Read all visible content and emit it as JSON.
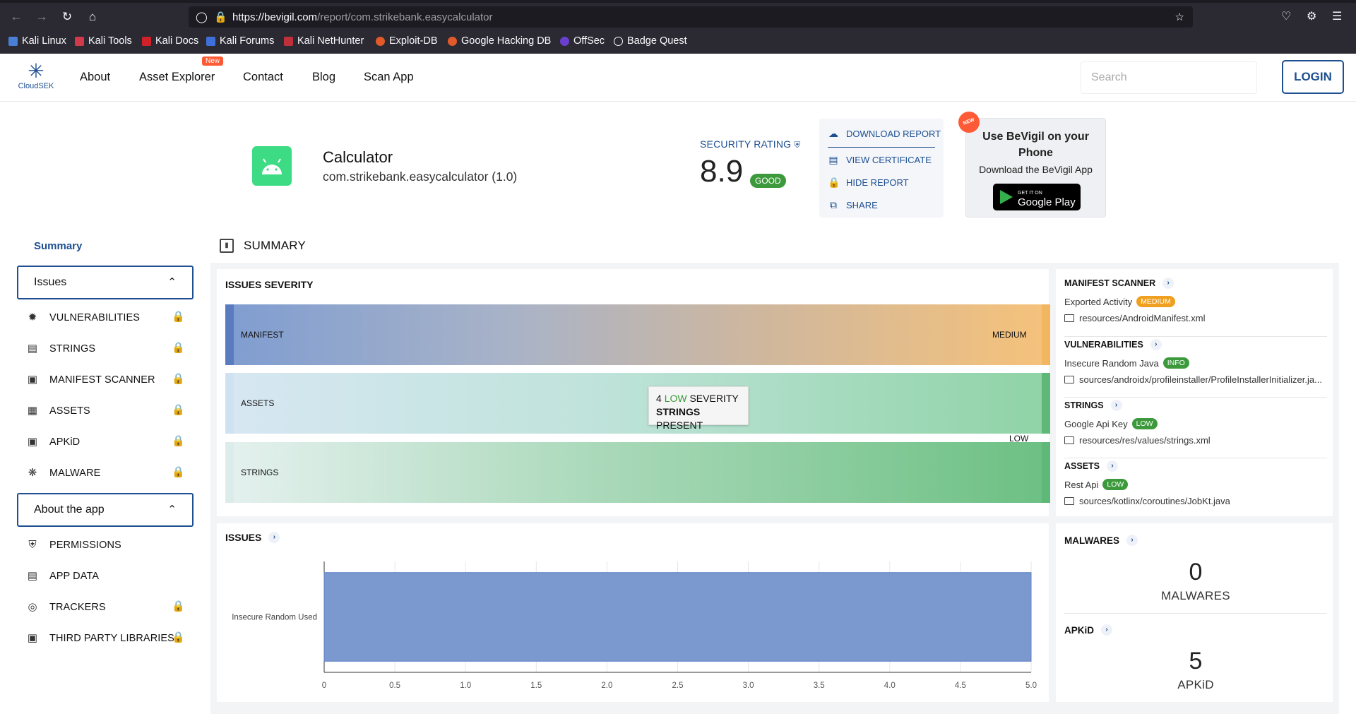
{
  "browser": {
    "url_host": "https://bevigil.com",
    "url_path": "/report/com.strikebank.easycalculator",
    "bookmarks": [
      "Kali Linux",
      "Kali Tools",
      "Kali Docs",
      "Kali Forums",
      "Kali NetHunter",
      "Exploit-DB",
      "Google Hacking DB",
      "OffSec",
      "Badge Quest"
    ]
  },
  "header": {
    "logo_text": "CloudSEK",
    "nav": [
      "About",
      "Asset Explorer",
      "Contact",
      "Blog",
      "Scan App"
    ],
    "new_badge": "New",
    "search_placeholder": "Search",
    "login_label": "LOGIN"
  },
  "app": {
    "name": "Calculator",
    "package": "com.strikebank.easycalculator (1.0)",
    "security_label": "SECURITY RATING",
    "score": "8.9",
    "score_badge": "GOOD"
  },
  "actions": {
    "download": "DOWNLOAD REPORT",
    "certificate": "VIEW CERTIFICATE",
    "hide": "HIDE REPORT",
    "share": "SHARE"
  },
  "promo": {
    "badge": "NEW",
    "title": "Use BeVigil on your Phone",
    "subtitle": "Download the BeVigil App",
    "store_small": "GET IT ON",
    "store_big": "Google Play"
  },
  "sidebar": {
    "summary": "Summary",
    "issues_group": "Issues",
    "issues_items": [
      "VULNERABILITIES",
      "STRINGS",
      "MANIFEST SCANNER",
      "ASSETS",
      "APKiD",
      "MALWARE"
    ],
    "about_group": "About the app",
    "about_items": [
      "PERMISSIONS",
      "APP DATA",
      "TRACKERS",
      "THIRD PARTY LIBRARIES"
    ]
  },
  "summary": {
    "title": "SUMMARY",
    "severity_title": "ISSUES SEVERITY",
    "bands": [
      "MANIFEST",
      "ASSETS",
      "STRINGS"
    ],
    "medium_label": "MEDIUM",
    "low_label": "LOW",
    "tooltip": {
      "count": "4",
      "level": "LOW",
      "rest": "SEVERITY",
      "line2_bold": "STRINGS",
      "line2_rest": "PRESENT"
    }
  },
  "findings": [
    {
      "title": "MANIFEST SCANNER",
      "item": "Exported Activity",
      "severity": "MEDIUM",
      "path": "resources/AndroidManifest.xml"
    },
    {
      "title": "VULNERABILITIES",
      "item": "Insecure Random Java",
      "severity": "INFO",
      "path": "sources/androidx/profileinstaller/ProfileInstallerInitializer.ja..."
    },
    {
      "title": "STRINGS",
      "item": "Google Api Key",
      "severity": "LOW",
      "path": "resources/res/values/strings.xml"
    },
    {
      "title": "ASSETS",
      "item": "Rest Api",
      "severity": "LOW",
      "path": "sources/kotlinx/coroutines/JobKt.java"
    }
  ],
  "issues": {
    "title": "ISSUES"
  },
  "malwares": {
    "title": "MALWARES",
    "value": "0",
    "label": "MALWARES"
  },
  "apkid": {
    "title": "APKiD",
    "value": "5",
    "label": "APKiD"
  },
  "chart_data": {
    "type": "bar",
    "orientation": "horizontal",
    "categories": [
      "Insecure Random Used"
    ],
    "values": [
      5
    ],
    "xlim": [
      0,
      5
    ],
    "ticks": [
      "0",
      "0.5",
      "1.0",
      "1.5",
      "2.0",
      "2.5",
      "3.0",
      "3.5",
      "4.0",
      "4.5",
      "5.0"
    ],
    "bar_color": "#7b98cf",
    "grid": true
  }
}
